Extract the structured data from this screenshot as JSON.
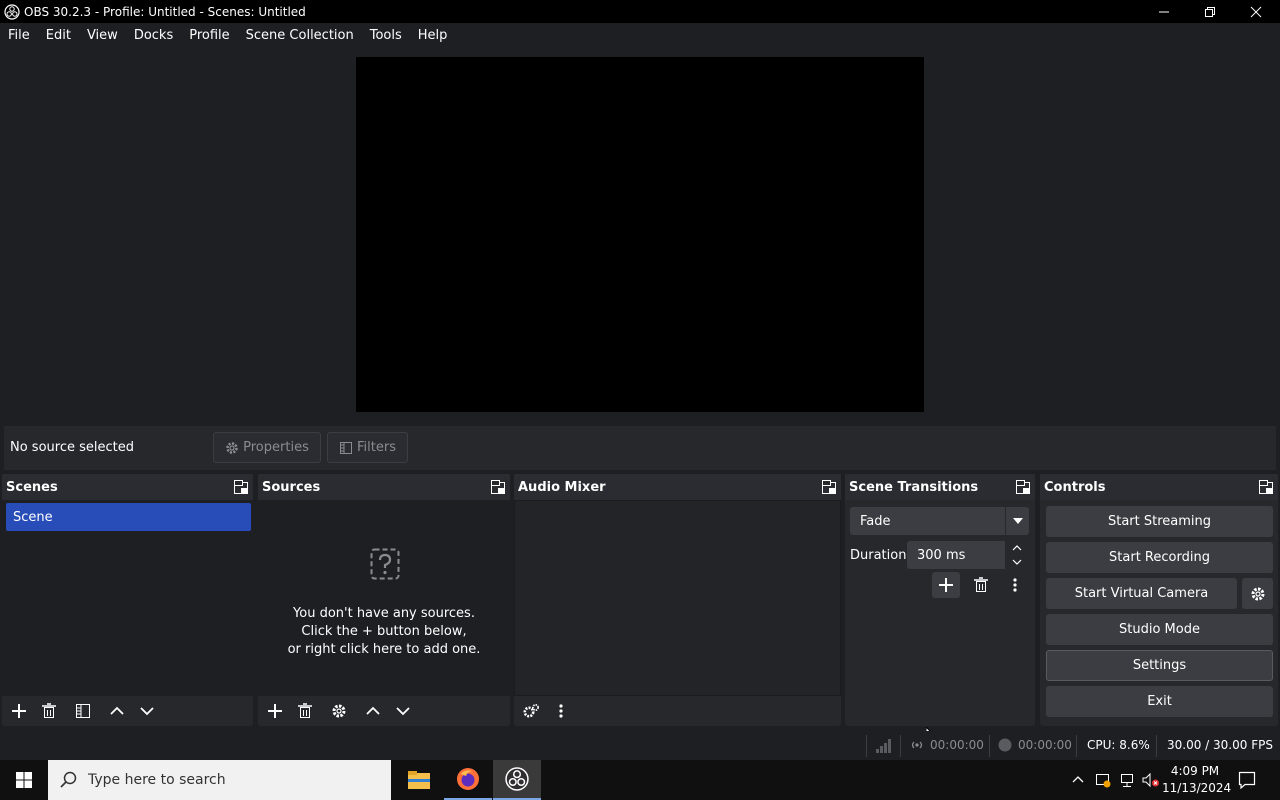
{
  "window": {
    "title": "OBS 30.2.3 - Profile: Untitled - Scenes: Untitled"
  },
  "menu": [
    "File",
    "Edit",
    "View",
    "Docks",
    "Profile",
    "Scene Collection",
    "Tools",
    "Help"
  ],
  "context": {
    "no_source": "No source selected",
    "properties": "Properties",
    "filters": "Filters"
  },
  "docks": {
    "scenes": {
      "title": "Scenes",
      "items": [
        "Scene"
      ]
    },
    "sources": {
      "title": "Sources",
      "empty_line1": "You don't have any sources.",
      "empty_line2": "Click the + button below,",
      "empty_line3": "or right click here to add one."
    },
    "mixer": {
      "title": "Audio Mixer"
    },
    "transitions": {
      "title": "Scene Transitions",
      "selected": "Fade",
      "duration_label": "Duration",
      "duration_value": "300 ms"
    },
    "controls": {
      "title": "Controls",
      "start_streaming": "Start Streaming",
      "start_recording": "Start Recording",
      "start_virtual_camera": "Start Virtual Camera",
      "studio_mode": "Studio Mode",
      "settings": "Settings",
      "exit": "Exit"
    }
  },
  "status": {
    "stream_time": "00:00:00",
    "rec_time": "00:00:00",
    "cpu": "CPU: 8.6%",
    "fps": "30.00 / 30.00 FPS"
  },
  "taskbar": {
    "search_placeholder": "Type here to search",
    "time": "4:09 PM",
    "date": "11/13/2024"
  },
  "colors": {
    "accent": "#284cb8",
    "panel": "#27282c",
    "background": "#1e1f23",
    "button": "#3c3d42"
  }
}
